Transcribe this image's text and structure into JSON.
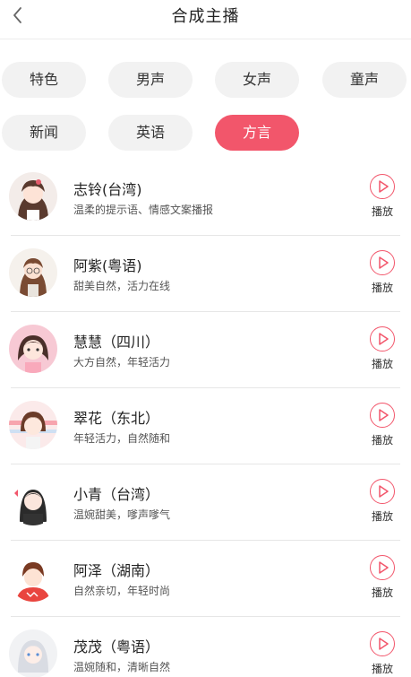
{
  "header": {
    "title": "合成主播"
  },
  "filters": [
    "特色",
    "男声",
    "女声",
    "童声",
    "新闻",
    "英语",
    "方言"
  ],
  "active_filter": "方言",
  "accent_color": "#f2566b",
  "play_label": "播放",
  "anchors": [
    {
      "name": "志铃(台湾)",
      "desc": "温柔的提示语、情感文案播报"
    },
    {
      "name": "阿紫(粤语)",
      "desc": "甜美自然，活力在线"
    },
    {
      "name": "慧慧（四川）",
      "desc": "大方自然，年轻活力"
    },
    {
      "name": "翠花（东北）",
      "desc": "年轻活力，自然随和"
    },
    {
      "name": "小青（台湾）",
      "desc": "温婉甜美，嗲声嗲气"
    },
    {
      "name": "阿泽（湖南）",
      "desc": "自然亲切，年轻时尚"
    },
    {
      "name": "茂茂（粤语）",
      "desc": "温婉随和，清晰自然"
    }
  ]
}
